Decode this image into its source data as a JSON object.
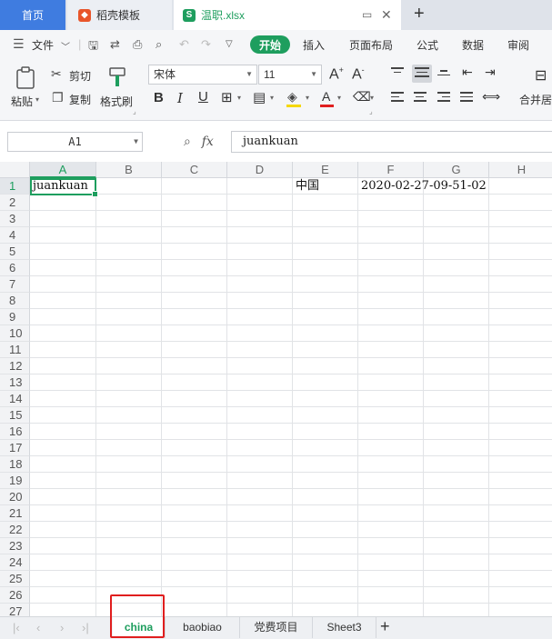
{
  "window": {
    "tabs": [
      {
        "label": "首页"
      },
      {
        "label": "稻壳模板"
      },
      {
        "label": "温职.xlsx"
      }
    ],
    "new_tab": "+"
  },
  "menu": {
    "file": "文件",
    "items": [
      "开始",
      "插入",
      "页面布局",
      "公式",
      "数据",
      "审阅"
    ]
  },
  "ribbon": {
    "paste": "粘贴",
    "cut": "剪切",
    "copy": "复制",
    "format_painter": "格式刷",
    "font_name": "宋体",
    "font_size": "11",
    "merge": "合并居"
  },
  "formula_bar": {
    "name_box": "A1",
    "fx": "fx",
    "content": "juankuan"
  },
  "grid": {
    "columns": [
      "A",
      "B",
      "C",
      "D",
      "E",
      "F",
      "G",
      "H"
    ],
    "rows": [
      "1",
      "2",
      "3",
      "4",
      "5",
      "6",
      "7",
      "8",
      "9",
      "10",
      "11",
      "12",
      "13",
      "14",
      "15",
      "16",
      "17",
      "18",
      "19",
      "20",
      "21",
      "22",
      "23",
      "24",
      "25",
      "26",
      "27"
    ],
    "cells": {
      "A1": "juankuan",
      "E1": "中国",
      "F1": "2020-02-27-09-51-02"
    },
    "selected": "A1"
  },
  "sheets": {
    "tabs": [
      "china",
      "baobiao",
      "党费项目",
      "Sheet3"
    ],
    "active": "china",
    "add": "+"
  },
  "colors": {
    "accent": "#1e9e5e",
    "home_tab": "#3f7ce0",
    "highlight": "#e01e1e"
  }
}
